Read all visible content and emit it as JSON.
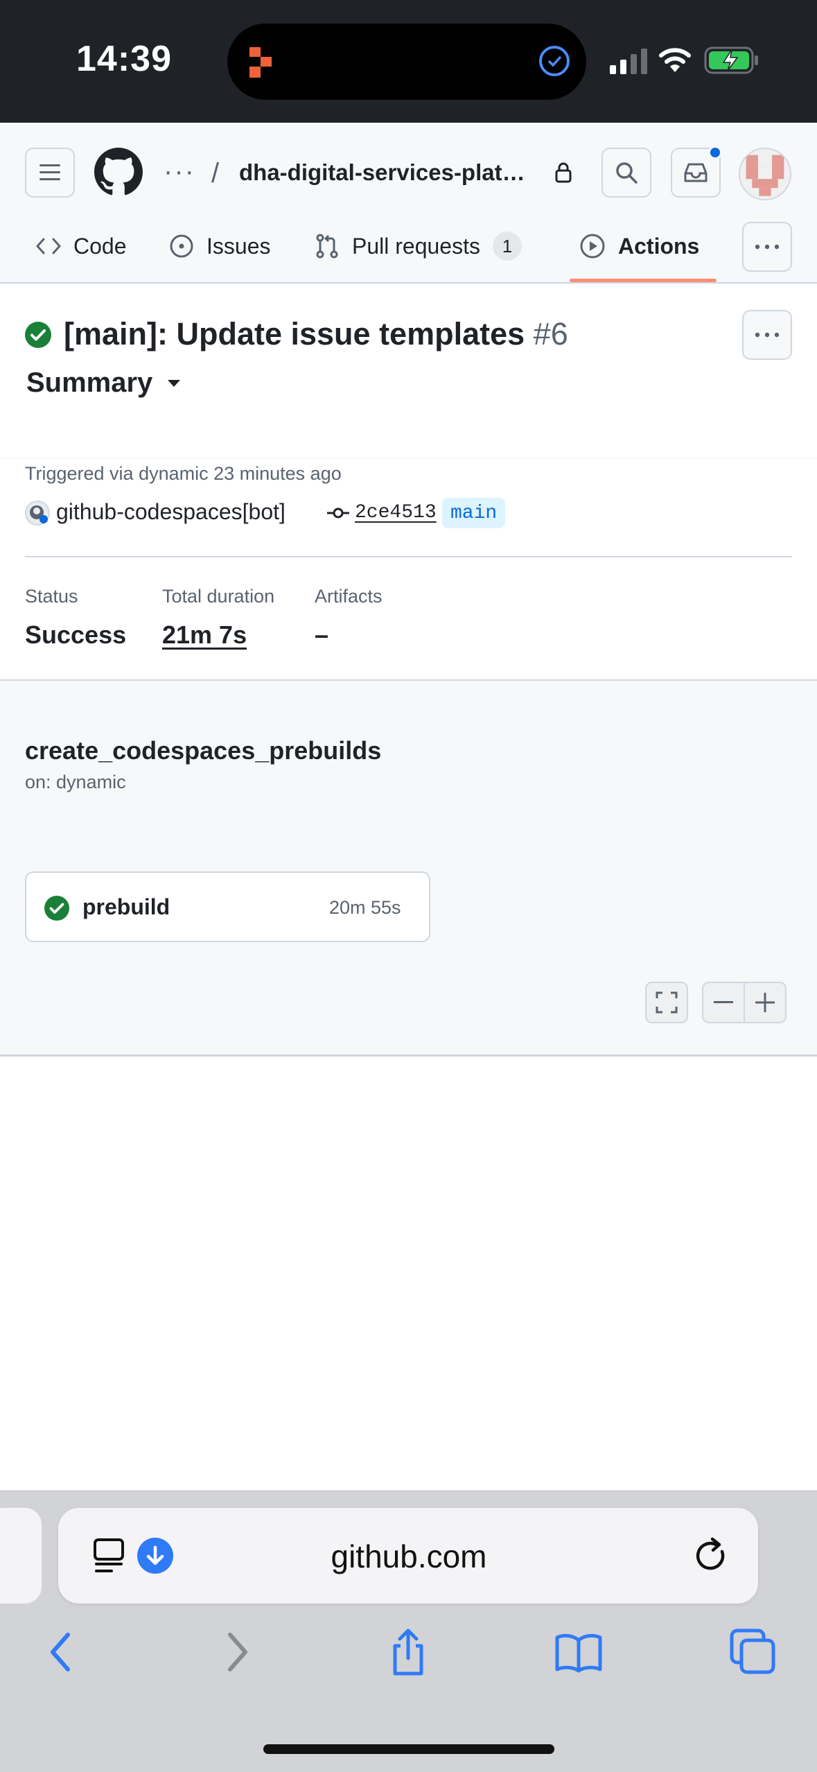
{
  "status_bar": {
    "time": "14:39"
  },
  "header": {
    "repo_ellipsis": "···",
    "separator": "/",
    "repo_name": "dha-digital-services-plat…"
  },
  "tabs": [
    {
      "label": "Code"
    },
    {
      "label": "Issues"
    },
    {
      "label": "Pull requests",
      "count": "1"
    },
    {
      "label": "Actions",
      "selected": true
    }
  ],
  "run": {
    "title": "[main]: Update issue templates",
    "number": "#6",
    "view_select": "Summary",
    "triggered": "Triggered via dynamic 23 minutes ago",
    "actor": "github-codespaces[bot]",
    "commit_sha": "2ce4513",
    "branch": "main",
    "stats": {
      "status_label": "Status",
      "status_value": "Success",
      "duration_label": "Total duration",
      "duration_value": "21m 7s",
      "artifacts_label": "Artifacts",
      "artifacts_value": "–"
    }
  },
  "workflow": {
    "name": "create_codespaces_prebuilds",
    "trigger": "on: dynamic",
    "jobs": [
      {
        "name": "prebuild",
        "duration": "20m 55s",
        "status": "success"
      }
    ]
  },
  "browser": {
    "url": "github.com"
  },
  "colors": {
    "success": "#1a7f37",
    "accent": "#0969da",
    "tab_underline": "#fd8c73",
    "safari_blue": "#2f7af7"
  }
}
